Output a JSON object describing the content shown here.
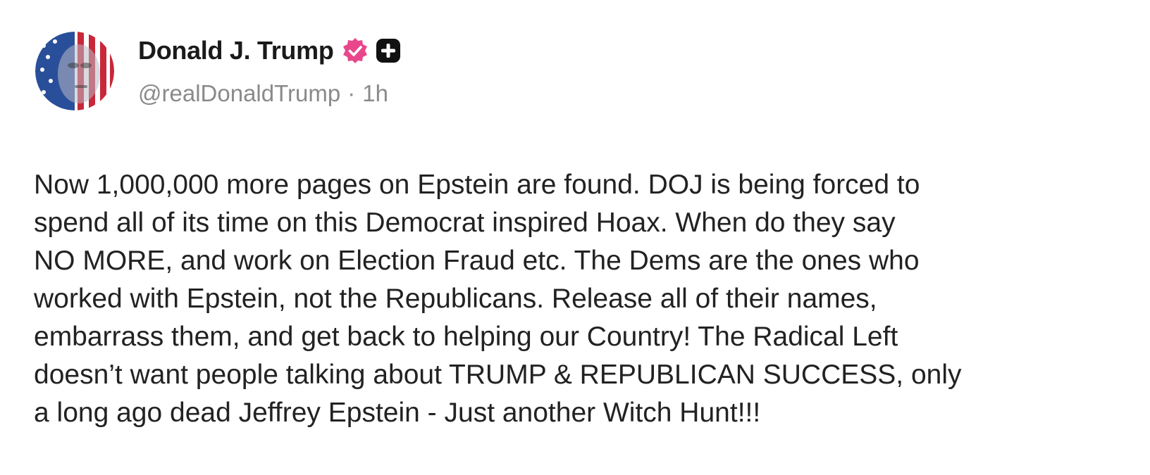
{
  "post": {
    "author": {
      "display_name": "Donald J. Trump",
      "handle": "@realDonaldTrump",
      "separator": "·",
      "time_ago": "1h",
      "avatar_icon": "flag-portrait-avatar",
      "verified_icon": "verified-badge-icon",
      "plus_icon": "plus-badge-icon"
    },
    "body": "Now 1,000,000 more pages on Epstein are found. DOJ is being forced to\nspend all of its time on this Democrat inspired Hoax. When do they say\nNO MORE, and work on Election Fraud etc. The Dems are the ones who\nworked with Epstein, not the Republicans. Release all of their names,\nembarrass them, and get back to helping our Country! The Radical Left\ndoesn’t want people talking about TRUMP & REPUBLICAN SUCCESS, only\na long ago dead Jeffrey Epstein - Just another Witch Hunt!!!"
  },
  "colors": {
    "verified": "#e8478b",
    "plus_badge": "#111111",
    "handle_text": "#8a8a8a",
    "body_text": "#222222"
  }
}
